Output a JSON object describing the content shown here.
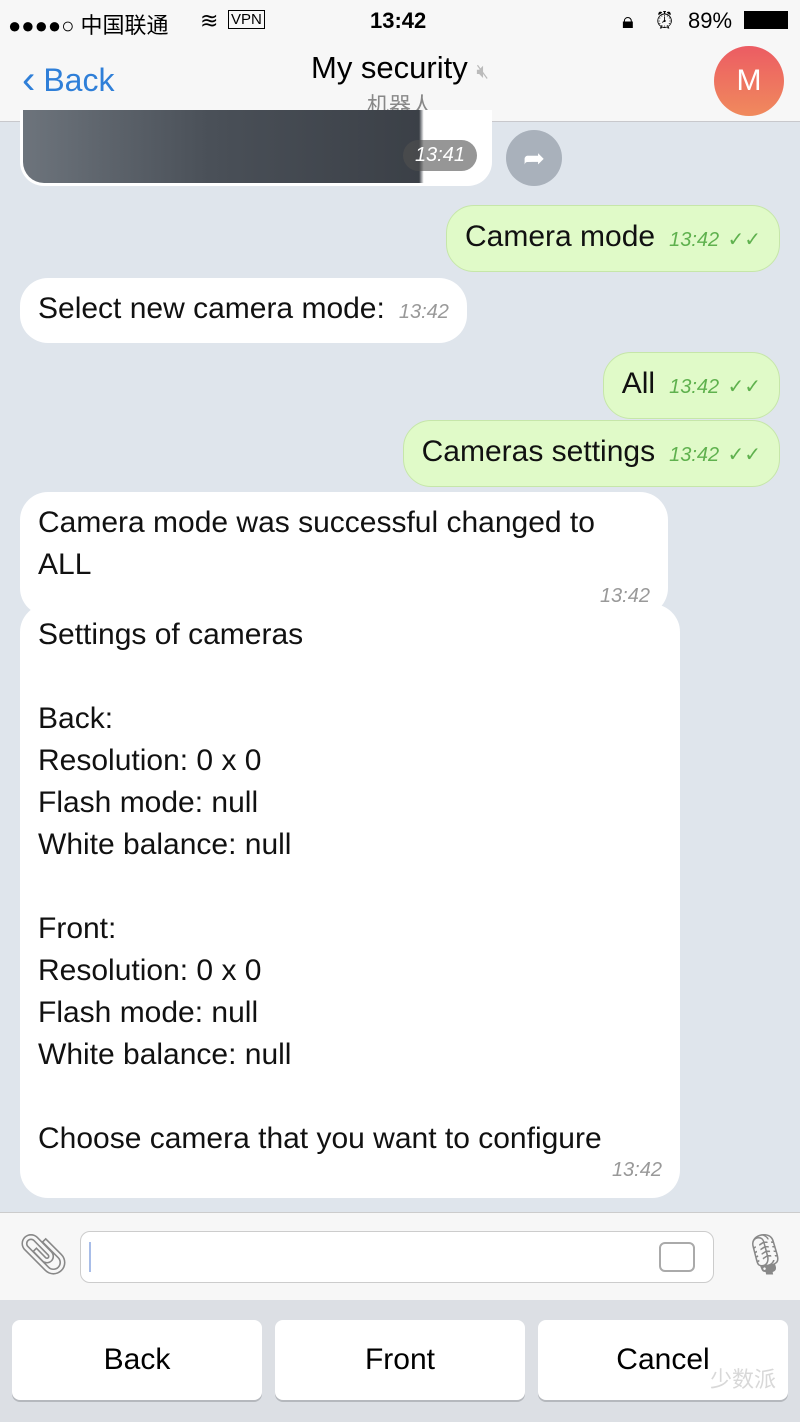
{
  "status": {
    "carrier": "●●●●○ 中国联通",
    "vpn": "VPN",
    "time": "13:42",
    "battery": "89%"
  },
  "nav": {
    "back": "Back",
    "title": "My security",
    "subtitle": "机器人",
    "avatar": "M"
  },
  "photo": {
    "time": "13:41"
  },
  "messages": [
    {
      "dir": "out",
      "text": "Camera mode",
      "time": "13:42"
    },
    {
      "dir": "in",
      "text": "Select new camera mode:",
      "time": "13:42"
    },
    {
      "dir": "out",
      "text": "All",
      "time": "13:42"
    },
    {
      "dir": "out",
      "text": "Cameras settings",
      "time": "13:42"
    },
    {
      "dir": "in",
      "text": "Camera mode was successful changed to ALL",
      "time": "13:42"
    },
    {
      "dir": "in",
      "text": "Settings of cameras\n\nBack:\nResolution: 0 x 0\nFlash mode: null\nWhite balance: null\n\nFront:\nResolution: 0 x 0\nFlash mode: null\nWhite balance: null\n\nChoose camera that you want to configure",
      "time": "13:42"
    }
  ],
  "input": {
    "value": ""
  },
  "keyboard": [
    "Back",
    "Front",
    "Cancel"
  ],
  "watermark": "少数派"
}
